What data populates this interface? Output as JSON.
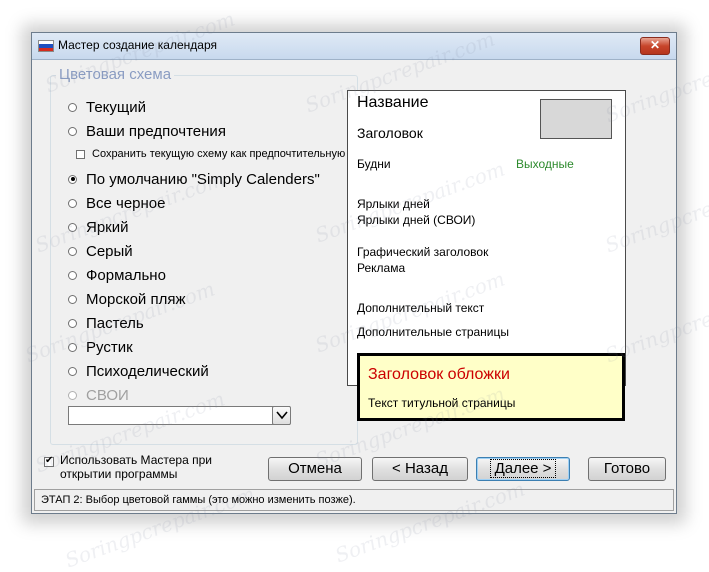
{
  "window": {
    "title": "Мастер создание календаря",
    "close_label": "✕"
  },
  "scheme": {
    "group_label": "Цветовая схема",
    "options": [
      {
        "label": "Текущий",
        "checked": false,
        "disabled": false
      },
      {
        "label": "Ваши предпочтения",
        "checked": false,
        "disabled": false
      },
      {
        "label": "По умолчанию \"Simply Calenders\"",
        "checked": true,
        "disabled": false
      },
      {
        "label": "Все черное",
        "checked": false,
        "disabled": false
      },
      {
        "label": "Яркий",
        "checked": false,
        "disabled": false
      },
      {
        "label": "Серый",
        "checked": false,
        "disabled": false
      },
      {
        "label": "Формально",
        "checked": false,
        "disabled": false
      },
      {
        "label": "Морской пляж",
        "checked": false,
        "disabled": false
      },
      {
        "label": "Пастель",
        "checked": false,
        "disabled": false
      },
      {
        "label": "Рустик",
        "checked": false,
        "disabled": false
      },
      {
        "label": "Психоделический",
        "checked": false,
        "disabled": false
      },
      {
        "label": "СВОИ",
        "checked": false,
        "disabled": true
      }
    ],
    "save_checkbox_label": "Сохранить текущую схему как предпочтительную",
    "custom_select_value": ""
  },
  "preview": {
    "title": "Название",
    "header": "Заголовок",
    "weekdays": "Будни",
    "weekends": "Выходные",
    "day_labels": "Ярлыки дней",
    "day_labels_custom": "Ярлыки дней (СВОИ)",
    "graphic_header": "Графический заголовок",
    "ad": "Реклама",
    "extra_text": "Дополнительный текст",
    "extra_pages": "Дополнительные страницы",
    "cover_title": "Заголовок обложки",
    "cover_text": "Текст титульной страницы",
    "colors": {
      "weekends": "#2e8b2e",
      "cover_title": "#cc0000",
      "cover_bg": "#ffffc8"
    }
  },
  "footer": {
    "use_wizard_line1": "Использовать Мастера при",
    "use_wizard_line2": "открытии программы",
    "use_wizard_checked": true,
    "cancel": "Отмена",
    "back": "< Назад",
    "next": "Далее >",
    "finish": "Готово",
    "status": "ЭТАП 2: Выбор цветовой гаммы (это можно изменить позже)."
  },
  "watermark": "Soringpcrepair.com"
}
